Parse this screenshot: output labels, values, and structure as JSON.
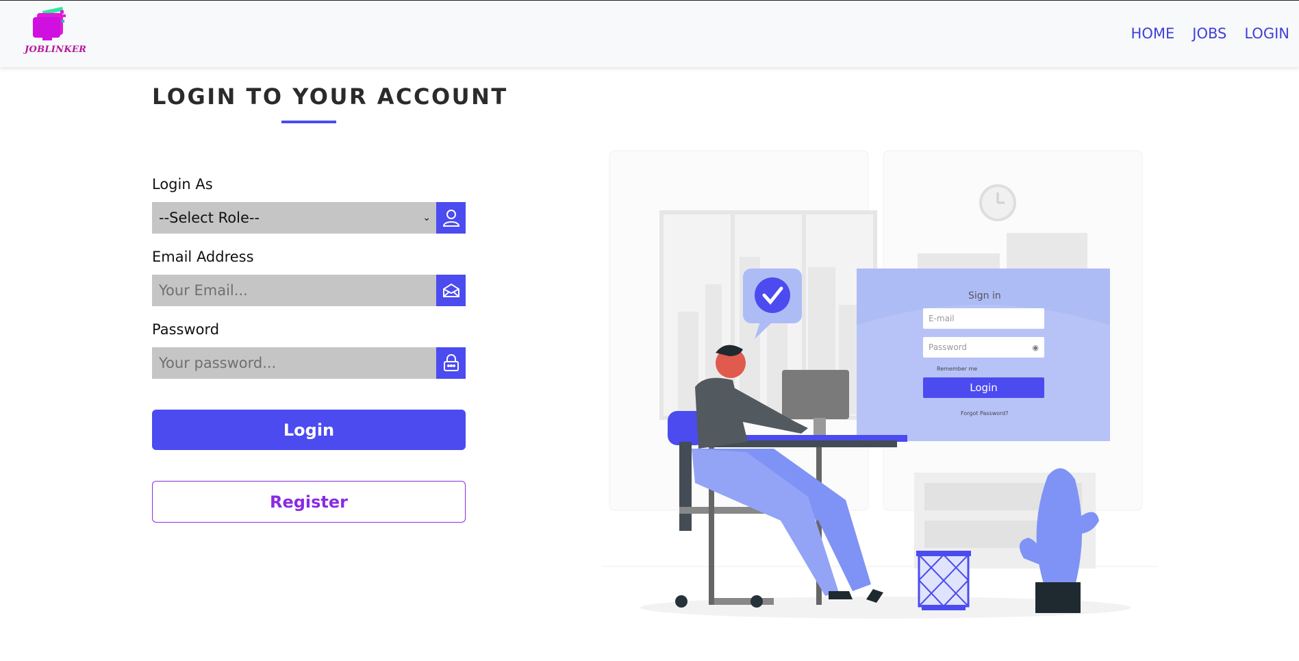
{
  "header": {
    "logo_text": "JOBLINKER",
    "nav": [
      "HOME",
      "JOBS",
      "LOGIN"
    ]
  },
  "form": {
    "title": "LOGIN TO YOUR ACCOUNT",
    "role_label": "Login As",
    "role_value": "--Select Role--",
    "email_label": "Email Address",
    "email_placeholder": "Your Email...",
    "password_label": "Password",
    "password_placeholder": "Your password...",
    "login_button": "Login",
    "register_button": "Register"
  },
  "illustration": {
    "title": "Sign in",
    "email_placeholder": "E-mail",
    "password_placeholder": "Password",
    "remember": "Remember me",
    "login": "Login",
    "forgot": "Forgot Password?"
  },
  "colors": {
    "accent": "#4b4bf0",
    "register": "#8a2be2",
    "logo": "#b5179e",
    "field_bg": "#c5c5c5"
  }
}
